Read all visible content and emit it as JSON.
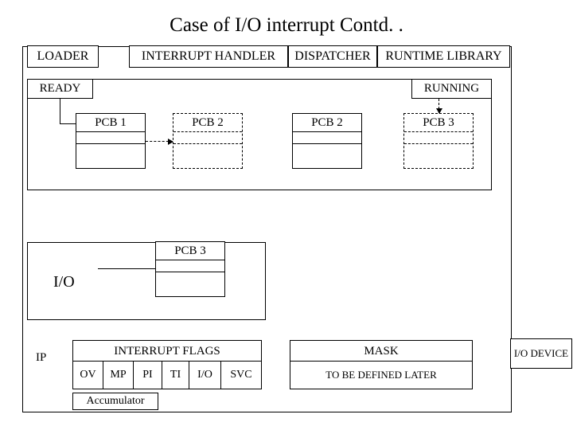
{
  "title": "Case of I/O interrupt Contd. .",
  "top_modules": {
    "loader": "LOADER",
    "handler": "INTERRUPT HANDLER",
    "dispatcher": "DISPATCHER",
    "runtime": "RUNTIME LIBRARY"
  },
  "queues": {
    "ready_label": "READY",
    "running_label": "RUNNING",
    "pcb1": "PCB 1",
    "pcb2_dashed": "PCB 2",
    "pcb2_solid": "PCB 2",
    "pcb3_dashed": "PCB 3",
    "pcb3_solid": "PCB 3"
  },
  "io": {
    "label": "I/O"
  },
  "ip_label": "IP",
  "interrupt_flags": {
    "header": "INTERRUPT FLAGS",
    "cells": [
      "OV",
      "MP",
      "PI",
      "TI",
      "I/O",
      "SVC"
    ]
  },
  "mask": {
    "header": "MASK",
    "body": "TO BE DEFINED LATER"
  },
  "accumulator": "Accumulator",
  "io_device": "I/O DEVICE"
}
